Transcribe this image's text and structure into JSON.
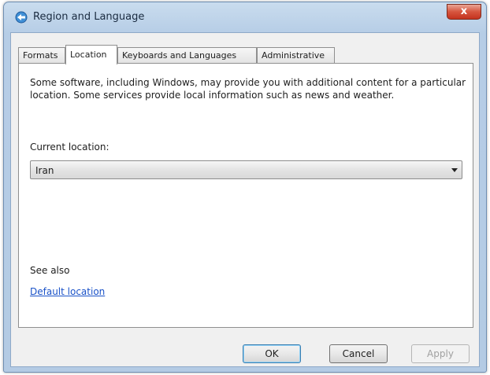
{
  "window": {
    "title": "Region and Language",
    "close_label": "x"
  },
  "tabs": [
    {
      "label": "Formats",
      "active": false
    },
    {
      "label": "Location",
      "active": true
    },
    {
      "label": "Keyboards and Languages",
      "active": false
    },
    {
      "label": "Administrative",
      "active": false
    }
  ],
  "location_tab": {
    "description": "Some software, including Windows, may provide you with additional content for a particular location. Some services provide local information such as news and weather.",
    "current_location_label": "Current location:",
    "current_location_value": "Iran",
    "see_also_label": "See also",
    "default_location_link": "Default location"
  },
  "buttons": {
    "ok": "OK",
    "cancel": "Cancel",
    "apply": "Apply"
  },
  "colors": {
    "link": "#1a52c8",
    "close_button": "#c4331f",
    "titlebar": "#b6cde6"
  }
}
